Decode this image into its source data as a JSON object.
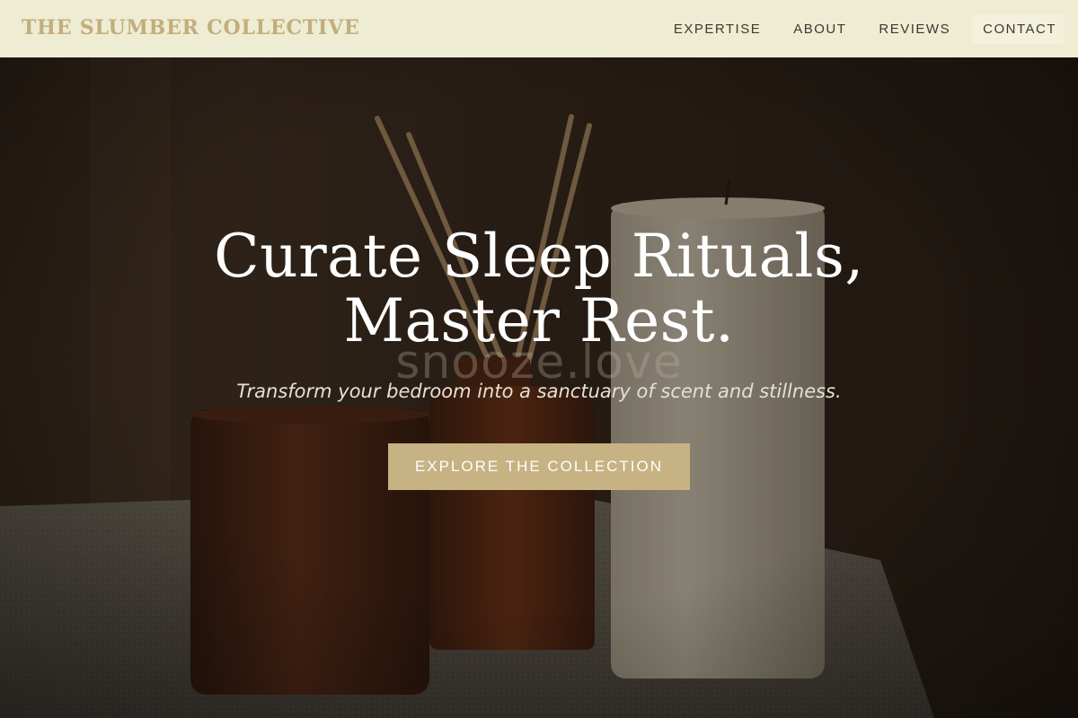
{
  "header": {
    "brand": "THE SLUMBER COLLECTIVE",
    "nav": [
      {
        "label": "EXPERTISE"
      },
      {
        "label": "ABOUT"
      },
      {
        "label": "REVIEWS"
      },
      {
        "label": "CONTACT"
      }
    ]
  },
  "hero": {
    "headline_line1": "Curate Sleep Rituals,",
    "headline_line2": "Master Rest.",
    "watermark": "snooze.love",
    "subtitle": "Transform your bedroom into a sanctuary of scent and stillness.",
    "cta_label": "EXPLORE THE COLLECTION",
    "background_image": "candles-diffuser-still-life"
  },
  "colors": {
    "header_bg": "#eeecd2",
    "brand": "#c2ad7c",
    "nav_text": "#3c3a30",
    "cta_bg": "#c6b283",
    "hero_overlay": "#1e160e"
  }
}
